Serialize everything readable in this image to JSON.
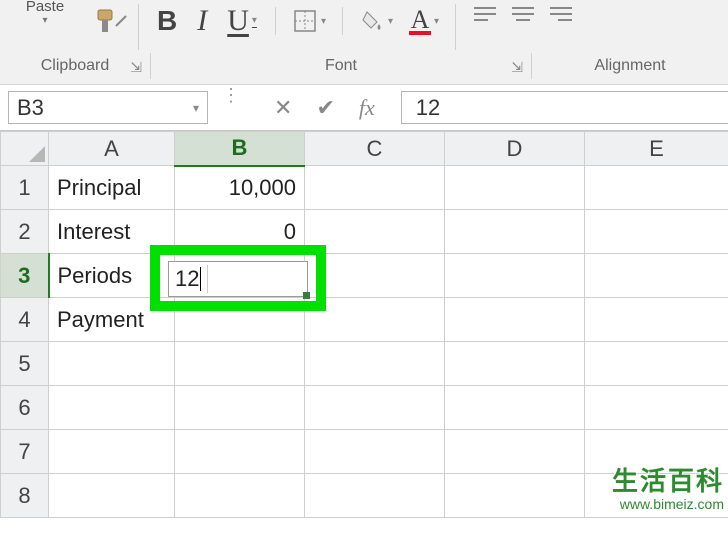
{
  "ribbon": {
    "paste_label": "Paste",
    "bold": "B",
    "italic": "I",
    "underline": "U",
    "font_color_letter": "A",
    "group_clipboard": "Clipboard",
    "group_font": "Font",
    "group_alignment": "Alignment"
  },
  "formula_bar": {
    "name_box": "B3",
    "fx_label": "fx",
    "formula_value": "12"
  },
  "columns": [
    "A",
    "B",
    "C",
    "D",
    "E"
  ],
  "rows": [
    "1",
    "2",
    "3",
    "4",
    "5",
    "6",
    "7",
    "8"
  ],
  "active": {
    "col": "B",
    "row": "3"
  },
  "cells": {
    "A1": "Principal",
    "B1": "10,000",
    "A2": "Interest",
    "B2": "0",
    "A3": "Periods",
    "B3": "12",
    "A4": "Payment"
  },
  "watermark": {
    "line1": "生活百科",
    "line2": "www.bimeiz.com"
  }
}
